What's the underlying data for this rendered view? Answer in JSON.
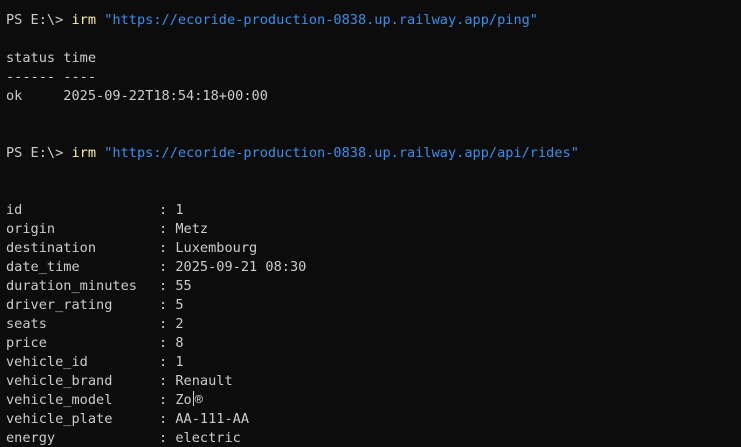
{
  "colors": {
    "background": "#0c0c0c",
    "foreground": "#cccccc",
    "command": "#f9f1a5",
    "string_arg": "#3b8eea"
  },
  "session": [
    {
      "prompt": "PS E:\\> ",
      "command": "irm",
      "argument": "\"https://ecoride-production-0838.up.railway.app/ping\""
    },
    {
      "prompt": "PS E:\\> ",
      "command": "irm",
      "argument": "\"https://ecoride-production-0838.up.railway.app/api/rides\""
    }
  ],
  "ping_table": {
    "headers": "status time",
    "rule": "------ ----",
    "row": "ok     2025-09-22T18:54:18+00:00"
  },
  "ride": [
    {
      "key": "id",
      "value": "1"
    },
    {
      "key": "origin",
      "value": "Metz"
    },
    {
      "key": "destination",
      "value": "Luxembourg"
    },
    {
      "key": "date_time",
      "value": "2025-09-21 08:30"
    },
    {
      "key": "duration_minutes",
      "value": "55"
    },
    {
      "key": "driver_rating",
      "value": "5"
    },
    {
      "key": "seats",
      "value": "2"
    },
    {
      "key": "price",
      "value": "8"
    },
    {
      "key": "vehicle_id",
      "value": "1"
    },
    {
      "key": "vehicle_brand",
      "value": "Renault"
    },
    {
      "key": "vehicle_model",
      "value_before": "Zo",
      "value_after": "®"
    },
    {
      "key": "vehicle_plate",
      "value": "AA-111-AA"
    },
    {
      "key": "energy",
      "value": "electric"
    }
  ],
  "kv_separator": ": "
}
